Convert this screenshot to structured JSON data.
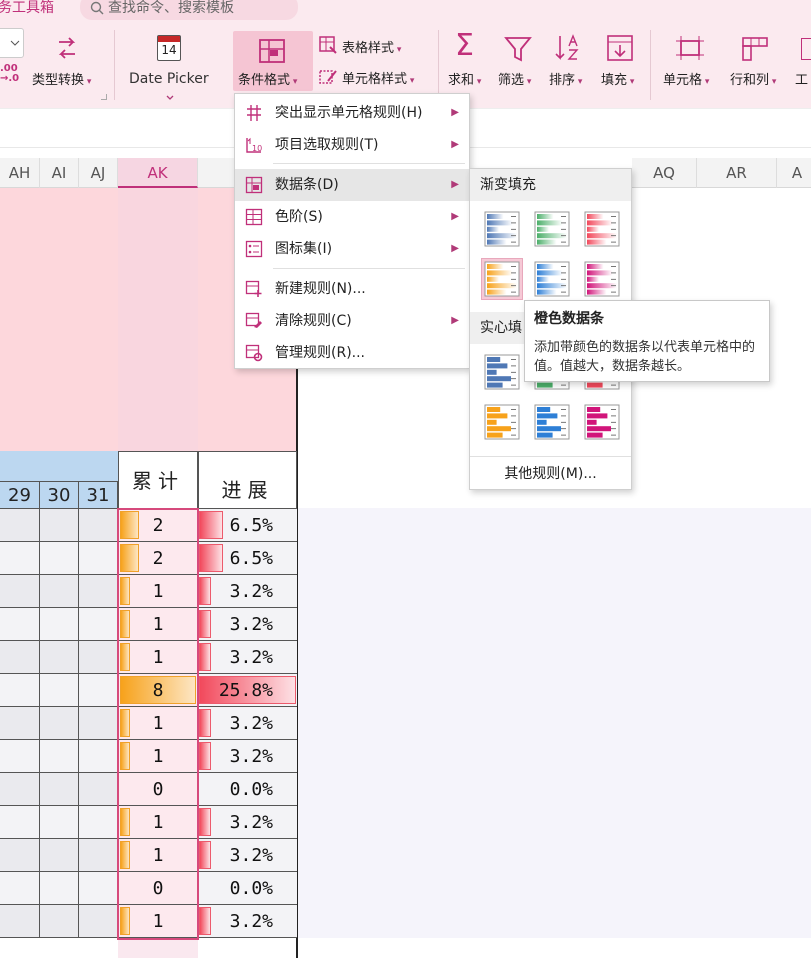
{
  "ribbon": {
    "toolbox_tab": "务工具箱",
    "search_placeholder": "查找命令、搜索模板",
    "type_convert": "类型转换",
    "date_picker": "Date Picker",
    "conditional_format": "条件格式",
    "table_style": "表格样式",
    "cell_style": "单元格样式",
    "sum": "求和",
    "filter": "筛选",
    "sort": "排序",
    "fill": "填充",
    "cell": "单元格",
    "row_col": "行和列",
    "work": "工",
    "calendar_day": "14",
    "decimal": ".00\n→.0"
  },
  "columns": {
    "left": [
      "AH",
      "AI",
      "AJ",
      "AK"
    ],
    "right": [
      "AQ",
      "AR",
      "A"
    ]
  },
  "menu": {
    "items": [
      {
        "label": "突出显示单元格规则(H)",
        "icon": "highlight-rules-icon",
        "submenu": true
      },
      {
        "label": "项目选取规则(T)",
        "icon": "top-rules-icon",
        "submenu": true
      },
      {
        "label": "数据条(D)",
        "icon": "databar-icon",
        "submenu": true
      },
      {
        "label": "色阶(S)",
        "icon": "color-scale-icon",
        "submenu": true
      },
      {
        "label": "图标集(I)",
        "icon": "icon-set-icon",
        "submenu": true
      },
      {
        "label": "新建规则(N)...",
        "icon": "new-rule-icon",
        "submenu": false
      },
      {
        "label": "清除规则(C)",
        "icon": "clear-rules-icon",
        "submenu": true
      },
      {
        "label": "管理规则(R)...",
        "icon": "manage-rules-icon",
        "submenu": false
      }
    ]
  },
  "submenu": {
    "gradient_title": "渐变填充",
    "solid_title": "实心填",
    "more_rules": "其他规则(M)..."
  },
  "tooltip": {
    "title": "橙色数据条",
    "body": "添加带颜色的数据条以代表单元格中的值。值越大，数据条越长。"
  },
  "table": {
    "day_headers": [
      "29",
      "30",
      "31"
    ],
    "total_header": "累计",
    "progress_header": "进展",
    "rows": [
      {
        "total": "2",
        "progress": "6.5%",
        "total_frac": 0.25,
        "progress_frac": 0.25
      },
      {
        "total": "2",
        "progress": "6.5%",
        "total_frac": 0.25,
        "progress_frac": 0.25
      },
      {
        "total": "1",
        "progress": "3.2%",
        "total_frac": 0.125,
        "progress_frac": 0.125
      },
      {
        "total": "1",
        "progress": "3.2%",
        "total_frac": 0.125,
        "progress_frac": 0.125
      },
      {
        "total": "1",
        "progress": "3.2%",
        "total_frac": 0.125,
        "progress_frac": 0.125
      },
      {
        "total": "8",
        "progress": "25.8%",
        "total_frac": 1.0,
        "progress_frac": 1.0
      },
      {
        "total": "1",
        "progress": "3.2%",
        "total_frac": 0.125,
        "progress_frac": 0.125
      },
      {
        "total": "1",
        "progress": "3.2%",
        "total_frac": 0.125,
        "progress_frac": 0.125
      },
      {
        "total": "0",
        "progress": "0.0%",
        "total_frac": 0,
        "progress_frac": 0
      },
      {
        "total": "1",
        "progress": "3.2%",
        "total_frac": 0.125,
        "progress_frac": 0.125
      },
      {
        "total": "1",
        "progress": "3.2%",
        "total_frac": 0.125,
        "progress_frac": 0.125
      },
      {
        "total": "0",
        "progress": "0.0%",
        "total_frac": 0,
        "progress_frac": 0
      },
      {
        "total": "1",
        "progress": "3.2%",
        "total_frac": 0.125,
        "progress_frac": 0.125
      }
    ]
  },
  "colors": {
    "accent": "#c0307a",
    "ribbon_bg": "#fbeaef",
    "orange_bar": "#f7a21b",
    "red_bar": "#f2495c",
    "blue_bar": "#2e7fd6",
    "green_bar": "#4caf6a",
    "magenta_bar": "#d1157a",
    "steel_bar": "#4f78b5"
  }
}
